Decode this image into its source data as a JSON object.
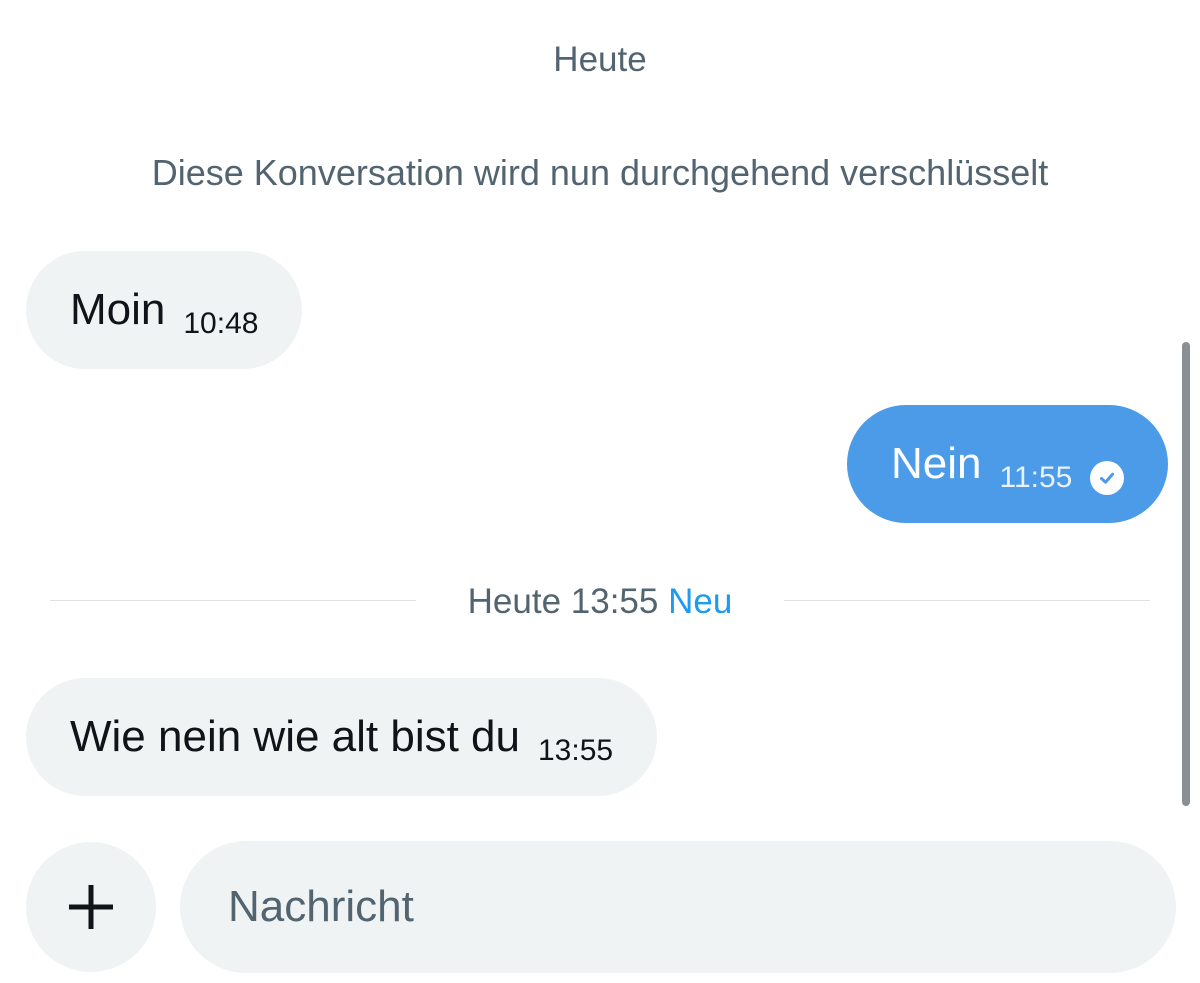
{
  "chat": {
    "day_label": "Heute",
    "encryption_notice": "Diese Konversation wird nun durchgehend verschlüsselt",
    "messages": [
      {
        "direction": "incoming",
        "text": "Moin",
        "time": "10:48"
      },
      {
        "direction": "outgoing",
        "text": "Nein",
        "time": "11:55",
        "status_icon": "read-check-icon"
      },
      {
        "direction": "incoming",
        "text": "Wie nein wie alt bist du",
        "time": "13:55"
      }
    ],
    "new_divider": {
      "label": "Heute 13:55",
      "badge": "Neu"
    }
  },
  "composer": {
    "add_icon": "plus-icon",
    "placeholder": "Nachricht",
    "value": ""
  },
  "colors": {
    "incoming_bubble": "#eff3f4",
    "outgoing_bubble": "#4c9be8",
    "accent": "#1d9bf0",
    "muted_text": "#536471"
  }
}
